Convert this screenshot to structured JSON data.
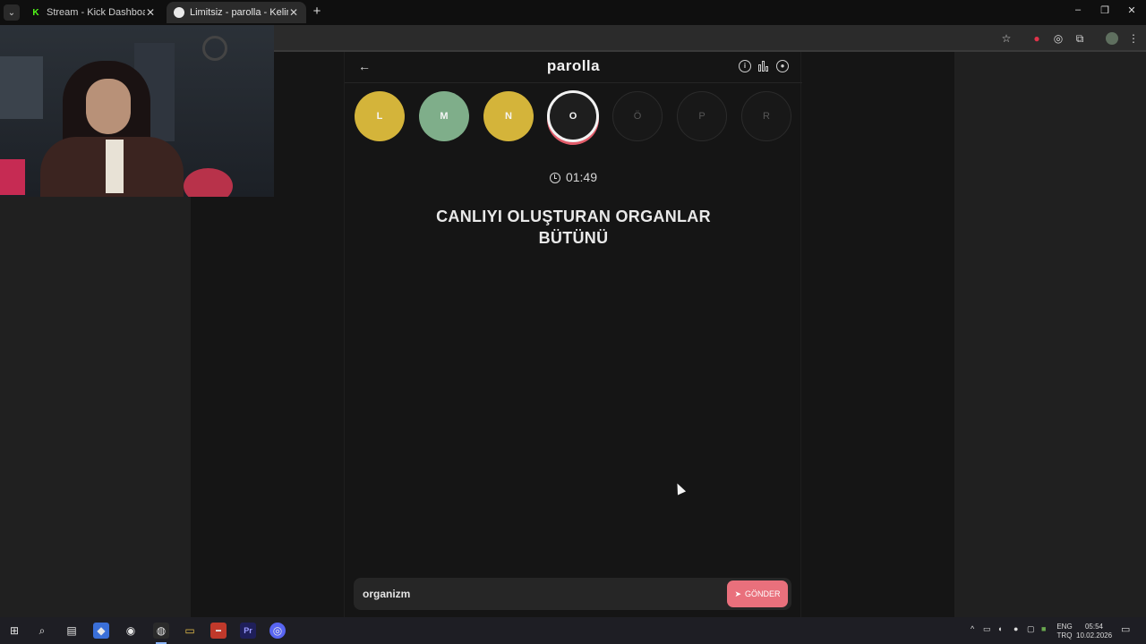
{
  "browser": {
    "tabs": [
      {
        "title": "Stream - Kick Dashboard",
        "icon": "kick-icon"
      },
      {
        "title": "Limitsiz - parolla - Kelime oyunu",
        "icon": "parolla-icon"
      }
    ],
    "new_tab_label": "+",
    "window_controls": [
      "–",
      "❐",
      "✕"
    ]
  },
  "app": {
    "title": "parolla",
    "letters": [
      {
        "letter": "L",
        "state": "answered-yellow"
      },
      {
        "letter": "M",
        "state": "correct-green"
      },
      {
        "letter": "N",
        "state": "answered-yellow"
      },
      {
        "letter": "O",
        "state": "current"
      },
      {
        "letter": "Ö",
        "state": "pending"
      },
      {
        "letter": "P",
        "state": "pending"
      },
      {
        "letter": "R",
        "state": "pending"
      }
    ],
    "timer": "01:49",
    "question_line1": "CANLIYI OLUŞTURAN ORGANLAR",
    "question_line2": "BÜTÜNÜ",
    "answer_value": "organizm",
    "send_label": "GÖNDER"
  },
  "colors": {
    "yellow": "#d4b43a",
    "green": "#7fae8a",
    "accent": "#e9707c"
  },
  "taskbar": {
    "lang_top": "ENG",
    "lang_bottom": "TRQ",
    "time": "05:54",
    "date": "10.02.2026"
  }
}
